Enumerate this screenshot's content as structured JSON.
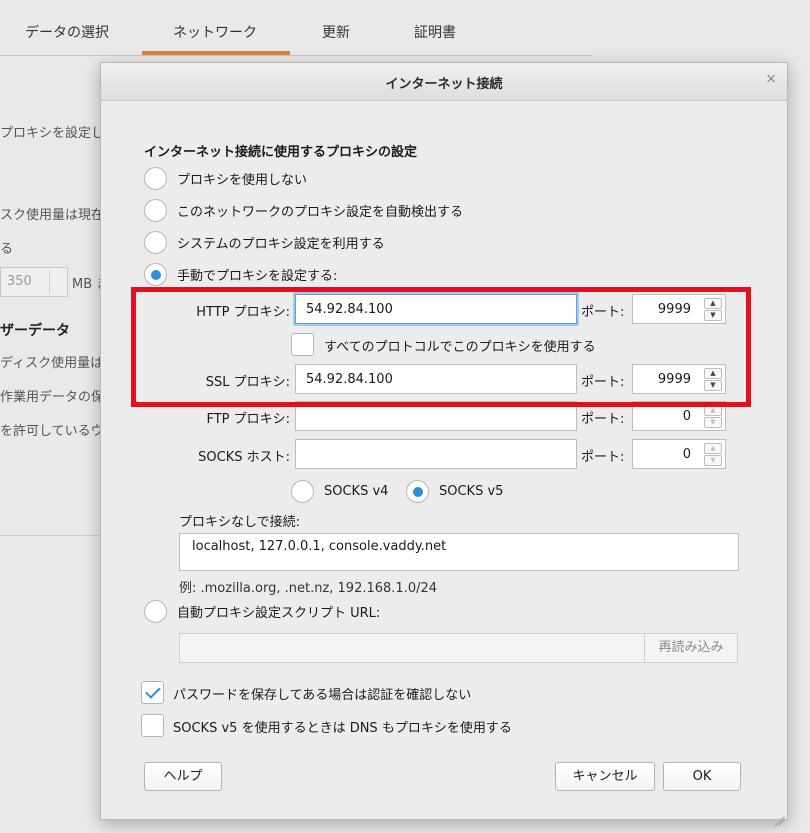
{
  "background": {
    "tabs": [
      "データの選択",
      "ネットワーク",
      "更新",
      "証明書"
    ],
    "active_tab_index": 1,
    "fragments": [
      "プロキシを設定し",
      "スク使用量は現在",
      "る",
      "350",
      "MB ま",
      "ザーデータ",
      "ディスク使用量は現",
      "作業用データの保",
      "を許可しているウ"
    ]
  },
  "dialog": {
    "title": "インターネット接続",
    "close_glyph": "×",
    "section_heading": "インターネット接続に使用するプロキシの設定",
    "radios": {
      "no_proxy": "プロキシを使用しない",
      "auto_detect": "このネットワークのプロキシ設定を自動検出する",
      "system": "システムのプロキシ設定を利用する",
      "manual": "手動でプロキシを設定する:"
    },
    "selected_mode": "manual",
    "http": {
      "label": "HTTP プロキシ:",
      "value": "54.92.84.100",
      "port_label": "ポート:",
      "port": "9999"
    },
    "share_all": {
      "label": "すべてのプロトコルでこのプロキシを使用する",
      "checked": false
    },
    "ssl": {
      "label": "SSL プロキシ:",
      "value": "54.92.84.100",
      "port_label": "ポート:",
      "port": "9999"
    },
    "ftp": {
      "label": "FTP プロキシ:",
      "value": "",
      "port_label": "ポート:",
      "port": "0"
    },
    "socks": {
      "label": "SOCKS ホスト:",
      "value": "",
      "port_label": "ポート:",
      "port": "0"
    },
    "socks_versions": {
      "v4": "SOCKS v4",
      "v5": "SOCKS v5",
      "selected": "v5"
    },
    "no_proxy_for": {
      "label": "プロキシなしで接続:",
      "value": "localhost, 127.0.0.1, console.vaddy.net"
    },
    "example": "例: .mozilla.org, .net.nz, 192.168.1.0/24",
    "auto_config": {
      "label": "自動プロキシ設定スクリプト URL:",
      "value": "",
      "reload_label": "再読み込み"
    },
    "no_prompt_auth": {
      "label": "パスワードを保存してある場合は認証を確認しない",
      "checked": true
    },
    "socks_dns": {
      "label": "SOCKS v5 を使用するときは DNS もプロキシを使用する",
      "checked": false
    },
    "buttons": {
      "help": "ヘルプ",
      "cancel": "キャンセル",
      "ok": "OK"
    }
  },
  "annotation": {
    "highlight_color": "#e2101f"
  },
  "colors": {
    "accent": "#2e8fd6",
    "tab_underline": "#e0813a"
  }
}
